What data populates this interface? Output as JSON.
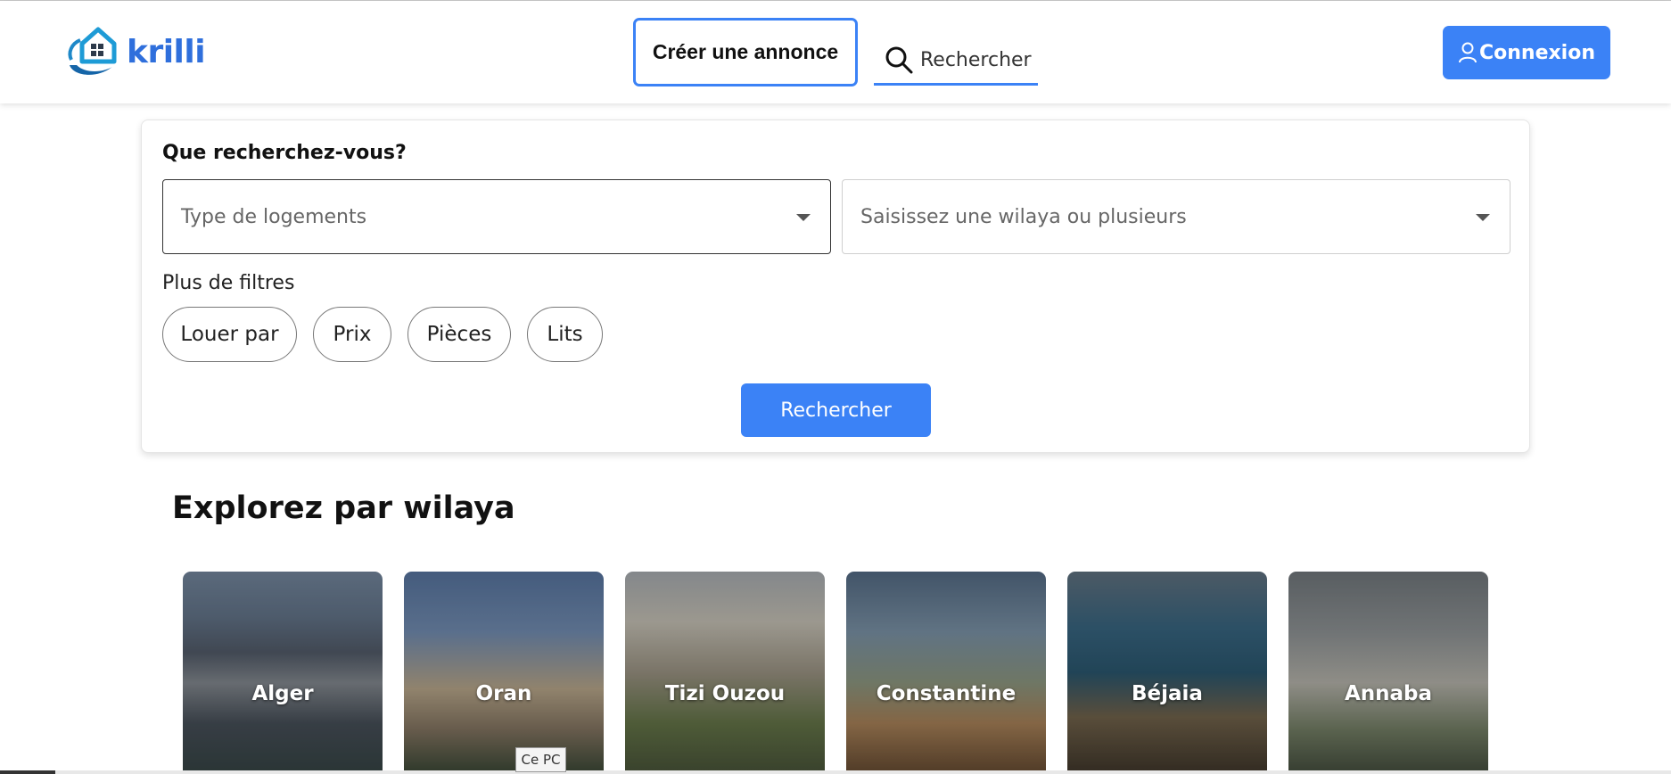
{
  "brand": {
    "name": "krilli",
    "accent": "#3b82f6",
    "logo_color": "#2f6fdc"
  },
  "header": {
    "create_label": "Créer une annonce",
    "search_placeholder": "Rechercher",
    "search_icon": "search-icon",
    "login_label": "Connexion",
    "login_icon": "user-icon"
  },
  "search_panel": {
    "title": "Que recherchez-vous?",
    "type_placeholder": "Type de logements",
    "wilaya_placeholder": "Saisissez une wilaya ou plusieurs",
    "filters_label": "Plus de filtres",
    "filters": [
      "Louer par",
      "Prix",
      "Pièces",
      "Lits"
    ],
    "search_button": "Rechercher"
  },
  "explore": {
    "title": "Explorez par wilaya",
    "cities": [
      "Alger",
      "Oran",
      "Tizi Ouzou",
      "Constantine",
      "Béjaia",
      "Annaba"
    ]
  },
  "tooltip": "Ce PC"
}
